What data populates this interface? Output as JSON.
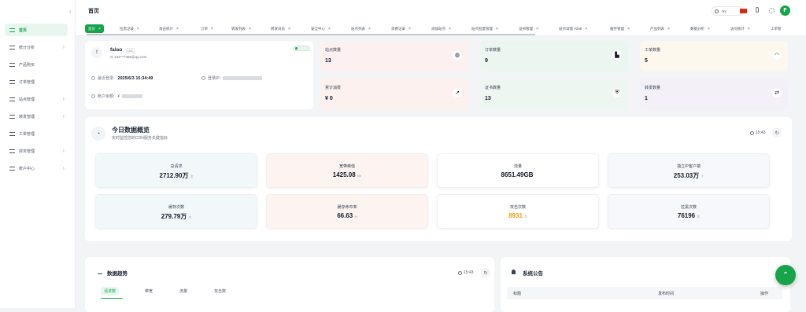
{
  "sidebar": {
    "items": [
      {
        "label": "首页",
        "active": true
      },
      {
        "label": "统计分析",
        "has_sub": true
      },
      {
        "label": "产品购买"
      },
      {
        "label": "订单管理"
      },
      {
        "label": "站点管理",
        "has_sub": true
      },
      {
        "label": "转发管理",
        "has_sub": true
      },
      {
        "label": "工单管理"
      },
      {
        "label": "财务管理",
        "has_sub": true
      },
      {
        "label": "账户中心",
        "has_sub": true
      }
    ]
  },
  "header": {
    "title": "首页",
    "search_shortcut": "⌘K",
    "avatar_letter": "F",
    "language": "zh-CN",
    "accent_color": "#16a34a"
  },
  "tabs": [
    {
      "label": "首页",
      "active": true
    },
    {
      "label": "拉黑记录"
    },
    {
      "label": "攻击统计"
    },
    {
      "label": "订单"
    },
    {
      "label": "转发列表"
    },
    {
      "label": "转发日志"
    },
    {
      "label": "安全中心"
    },
    {
      "label": "站点列表"
    },
    {
      "label": "消费记录"
    },
    {
      "label": "添加站点"
    },
    {
      "label": "站点批量管理"
    },
    {
      "label": "证书管理"
    },
    {
      "label": "站点详情 #258"
    },
    {
      "label": "缓存管理"
    },
    {
      "label": "产品列表"
    },
    {
      "label": "数据分析"
    },
    {
      "label": "访问统计"
    },
    {
      "label": "工单管"
    }
  ],
  "profile": {
    "avatar_letter": "f",
    "name": "falao",
    "level": "LV1",
    "email": "134****365@qq.com",
    "last_login_label": "最近登录:",
    "last_login": "2025/6/3 15:34:49",
    "login_ip_label": "登录IP:",
    "balance_label": "账户余额:",
    "balance_prefix": "¥"
  },
  "stats": [
    {
      "label": "站点数量",
      "value": "13",
      "icon": "globe-icon",
      "bg": "#fdf0f0"
    },
    {
      "label": "订单数量",
      "value": "9",
      "icon": "cart-icon",
      "bg": "#eaf6ef"
    },
    {
      "label": "工单数量",
      "value": "5",
      "icon": "headset-icon",
      "bg": "#fdf8ee"
    },
    {
      "label": "累计消费",
      "value": "¥ 0",
      "icon": "trend-icon",
      "bg": "#fdf1ef"
    },
    {
      "label": "证书数量",
      "value": "13",
      "icon": "shield-icon",
      "bg": "#eef6f1"
    },
    {
      "label": "转发数量",
      "value": "1",
      "icon": "swap-icon",
      "bg": "#f3f0f8"
    }
  ],
  "overview": {
    "title": "今日数据概览",
    "subtitle": "实时监控您的CDN服务关键指标",
    "time": "15:43",
    "metrics": [
      {
        "label": "总请求",
        "value": "2712.90万",
        "unit": "次",
        "bg": "#f2f8fa"
      },
      {
        "label": "宽带峰值",
        "value": "1425.08",
        "unit": "Mb",
        "bg": "#fdf4f2"
      },
      {
        "label": "流量",
        "value": "8651.49GB",
        "unit": "",
        "bg": "#ffffff"
      },
      {
        "label": "独立IP客户端",
        "value": "253.03万",
        "unit": "个",
        "bg": "#f7f8fb"
      },
      {
        "label": "缓存次数",
        "value": "279.79万",
        "unit": "次",
        "bg": "#f2f8fa"
      },
      {
        "label": "缓存命中率",
        "value": "66.63",
        "unit": "%",
        "bg": "#fdf4f2"
      },
      {
        "label": "攻击次数",
        "value": "8931",
        "unit": "次",
        "bg": "#ffffff",
        "highlight": true
      },
      {
        "label": "拉黑次数",
        "value": "76196",
        "unit": "次",
        "bg": "#f7f8fb"
      }
    ]
  },
  "trend": {
    "title": "数据趋势",
    "time": "15:43",
    "tabs": [
      "请求数",
      "带宽",
      "流量",
      "攻击数"
    ]
  },
  "notice": {
    "title": "系统公告",
    "columns": [
      "标题",
      "发布时间",
      "操作"
    ]
  }
}
